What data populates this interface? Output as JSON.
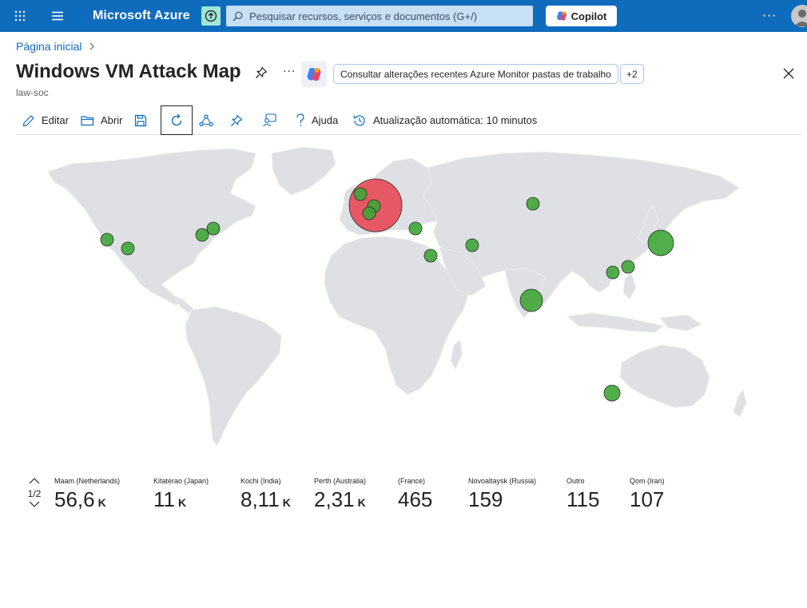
{
  "topbar": {
    "brand": "Microsoft Azure",
    "search_placeholder": "Pesquisar recursos, serviços e documentos (G+/)",
    "copilot_label": "Copilot",
    "more_label": "···",
    "accent_color": "#0f6cbd"
  },
  "breadcrumb": {
    "home": "Página inicial"
  },
  "page": {
    "title": "Windows VM Attack Map",
    "subtitle": "law-soc",
    "more_label": "···",
    "chip_label": "Consultar alterações recentes Azure Monitor pastas de trabalho",
    "chip_extra": "+2"
  },
  "toolbar": {
    "edit": "Editar",
    "open": "Abrir",
    "help": "Ajuda",
    "auto_refresh": "Atualização automática: 10 minutos"
  },
  "map": {
    "land_color": "#dfe0e3",
    "point_color": "#3fa536",
    "highlight_color": "#e8404d"
  },
  "legend": {
    "page": "1/2",
    "items": [
      {
        "label": "Maam (Netherlands)",
        "value": "56,6",
        "unit": "K"
      },
      {
        "label": "Kitaterao (Japan)",
        "value": "11",
        "unit": "K"
      },
      {
        "label": "Kochi (India)",
        "value": "8,11",
        "unit": "K"
      },
      {
        "label": "Perth (Australia)",
        "value": "2,31",
        "unit": "K"
      },
      {
        "label": "(France)",
        "value": "465",
        "unit": ""
      },
      {
        "label": "Novoaltaysk (Russia)",
        "value": "159",
        "unit": ""
      },
      {
        "label": "Outro",
        "value": "115",
        "unit": ""
      },
      {
        "label": "Qom (Iran)",
        "value": "107",
        "unit": ""
      }
    ]
  }
}
